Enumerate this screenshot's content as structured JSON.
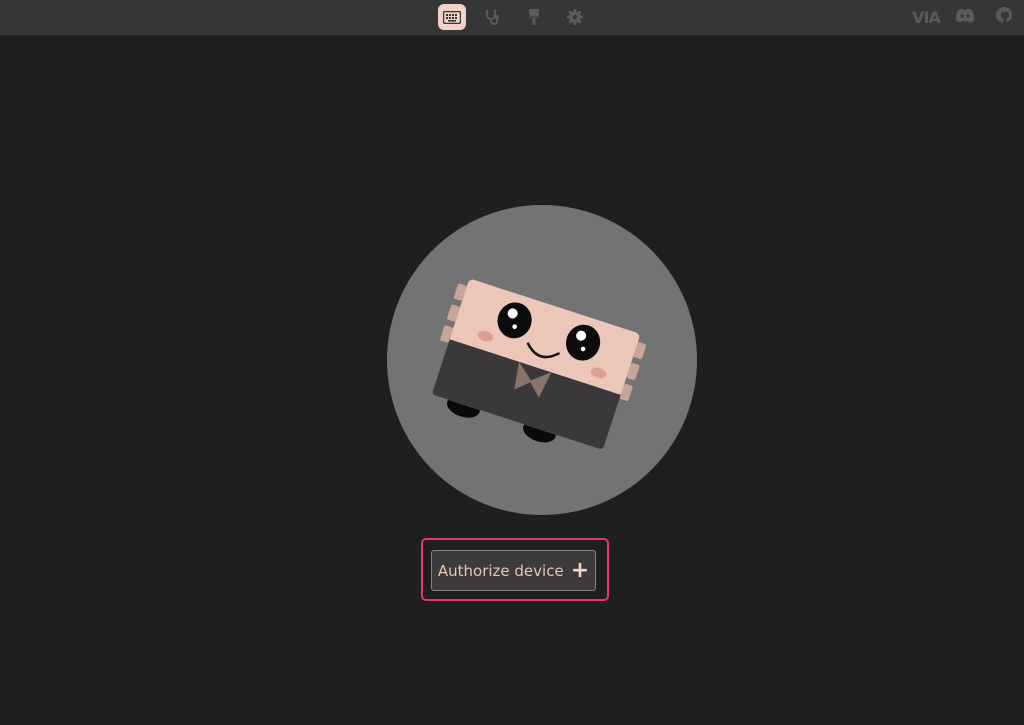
{
  "topbar": {
    "nav": [
      {
        "name": "configure",
        "icon": "keyboard-icon",
        "active": true
      },
      {
        "name": "test",
        "icon": "stethoscope-icon",
        "active": false
      },
      {
        "name": "design",
        "icon": "paintbrush-icon",
        "active": false
      },
      {
        "name": "settings",
        "icon": "gear-icon",
        "active": false
      }
    ],
    "via_logo": "VIA",
    "links": [
      {
        "icon": "discord-icon"
      },
      {
        "icon": "github-icon"
      }
    ]
  },
  "main": {
    "mascot": "keyboard-mascot-illustration",
    "authorize_button_label": "Authorize device",
    "authorize_button_icon": "plus-icon"
  },
  "colors": {
    "background": "#201f20",
    "topbar": "#363636",
    "accent": "#f0d3c8",
    "highlight": "#e8336c"
  }
}
